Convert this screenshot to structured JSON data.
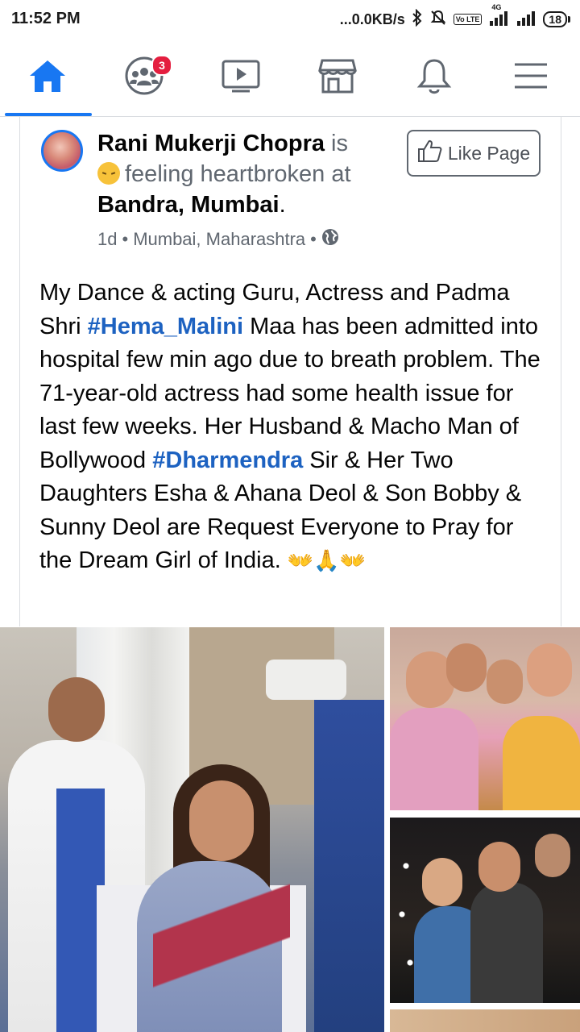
{
  "status_bar": {
    "time": "11:52 PM",
    "network_speed": "...0.0KB/s",
    "network_type": "4G",
    "lte_label": "Vo LTE",
    "battery_level": "18"
  },
  "nav": {
    "items": [
      {
        "name": "home",
        "icon": "home-icon",
        "active": true
      },
      {
        "name": "groups",
        "icon": "groups-icon",
        "badge": "3"
      },
      {
        "name": "watch",
        "icon": "play-icon"
      },
      {
        "name": "marketplace",
        "icon": "store-icon"
      },
      {
        "name": "notifications",
        "icon": "bell-icon"
      },
      {
        "name": "menu",
        "icon": "hamburger-icon"
      }
    ],
    "accent_color": "#1877f2"
  },
  "post": {
    "author": "Rani Mukerji Chopra",
    "verb": " is",
    "feeling": "feeling heartbroken at",
    "place": "Bandra, Mumbai",
    "place_suffix": ".",
    "time_ago": "1d",
    "location": "Mumbai, Maharashtra",
    "privacy_icon": "globe-icon",
    "like_page_label": "Like Page",
    "body": {
      "part1": "My Dance & acting Guru, Actress and Padma Shri ",
      "hashtag1": "#Hema_Malini",
      "part2": " Maa has been admitted into hospital few min ago due to breath problem. The 71-year-old actress had some health issue for last few weeks. Her Husband & Macho Man of Bollywood ",
      "hashtag2": "#Dharmendra",
      "part3": " Sir & Her Two Daughters Esha & Ahana Deol & Son Bobby & Sunny Deol are Request Everyone to Pray for the Dream Girl of India. ",
      "emojis": "👐🙏👐"
    }
  }
}
